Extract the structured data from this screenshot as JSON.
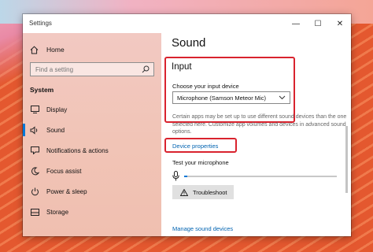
{
  "window": {
    "title": "Settings",
    "controls": {
      "minimize": "—",
      "maximize": "☐",
      "close": "✕"
    }
  },
  "sidebar": {
    "home_label": "Home",
    "search_placeholder": "Find a setting",
    "section_label": "System",
    "items": [
      {
        "label": "Display",
        "icon": "display-icon",
        "active": false
      },
      {
        "label": "Sound",
        "icon": "speaker-icon",
        "active": true
      },
      {
        "label": "Notifications & actions",
        "icon": "notifications-icon",
        "active": false
      },
      {
        "label": "Focus assist",
        "icon": "moon-icon",
        "active": false
      },
      {
        "label": "Power & sleep",
        "icon": "power-icon",
        "active": false
      },
      {
        "label": "Storage",
        "icon": "storage-icon",
        "active": false
      }
    ]
  },
  "main": {
    "title": "Sound",
    "input_heading": "Input",
    "choose_device_label": "Choose your input device",
    "selected_device": "Microphone (Samson Meteor Mic)",
    "help_text": "Certain apps may be set up to use different sound devices than the one selected here. Customize app volumes and devices in advanced sound options.",
    "device_properties_link": "Device properties",
    "test_mic_label": "Test your microphone",
    "mic_level": 0.02,
    "troubleshoot_label": "Troubleshoot",
    "manage_devices_link": "Manage sound devices"
  },
  "colors": {
    "accent": "#0078d7",
    "link": "#0063b1",
    "highlight_box": "#d9232e"
  }
}
